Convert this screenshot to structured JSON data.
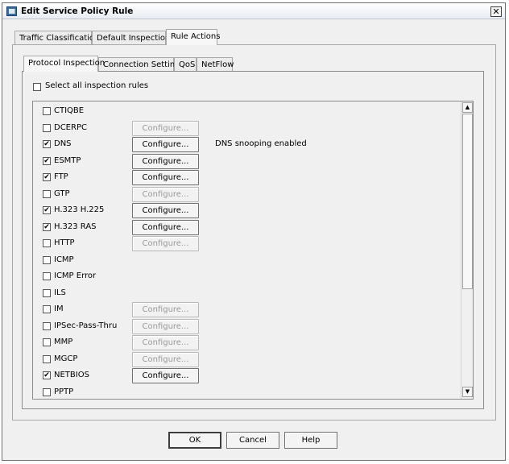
{
  "window": {
    "title": "Edit Service Policy Rule",
    "close_glyph": "✕"
  },
  "outer_tabs": [
    {
      "label": "Traffic Classification"
    },
    {
      "label": "Default Inspections"
    },
    {
      "label": "Rule Actions"
    }
  ],
  "inner_tabs": [
    {
      "label": "Protocol Inspection"
    },
    {
      "label": "Connection Settings"
    },
    {
      "label": "QoS"
    },
    {
      "label": "NetFlow"
    }
  ],
  "select_all": {
    "label": "Select all inspection rules",
    "checked": false
  },
  "rules": [
    {
      "name": "CTIQBE",
      "checked": false,
      "configure": null,
      "note": ""
    },
    {
      "name": "DCERPC",
      "checked": false,
      "configure": "Configure...",
      "enabled": false,
      "note": ""
    },
    {
      "name": "DNS",
      "checked": true,
      "configure": "Configure...",
      "enabled": true,
      "note": "DNS snooping enabled"
    },
    {
      "name": "ESMTP",
      "checked": true,
      "configure": "Configure...",
      "enabled": true,
      "note": ""
    },
    {
      "name": "FTP",
      "checked": true,
      "configure": "Configure...",
      "enabled": true,
      "note": ""
    },
    {
      "name": "GTP",
      "checked": false,
      "configure": "Configure...",
      "enabled": false,
      "note": ""
    },
    {
      "name": "H.323 H.225",
      "checked": true,
      "configure": "Configure...",
      "enabled": true,
      "note": ""
    },
    {
      "name": "H.323 RAS",
      "checked": true,
      "configure": "Configure...",
      "enabled": true,
      "note": ""
    },
    {
      "name": "HTTP",
      "checked": false,
      "configure": "Configure...",
      "enabled": false,
      "note": ""
    },
    {
      "name": "ICMP",
      "checked": false,
      "configure": null,
      "note": ""
    },
    {
      "name": "ICMP Error",
      "checked": false,
      "configure": null,
      "note": ""
    },
    {
      "name": "ILS",
      "checked": false,
      "configure": null,
      "note": ""
    },
    {
      "name": "IM",
      "checked": false,
      "configure": "Configure...",
      "enabled": false,
      "note": ""
    },
    {
      "name": "IPSec-Pass-Thru",
      "checked": false,
      "configure": "Configure...",
      "enabled": false,
      "note": ""
    },
    {
      "name": "MMP",
      "checked": false,
      "configure": "Configure...",
      "enabled": false,
      "note": ""
    },
    {
      "name": "MGCP",
      "checked": false,
      "configure": "Configure...",
      "enabled": false,
      "note": ""
    },
    {
      "name": "NETBIOS",
      "checked": true,
      "configure": "Configure...",
      "enabled": true,
      "note": ""
    },
    {
      "name": "PPTP",
      "checked": false,
      "configure": null,
      "note": ""
    }
  ],
  "buttons": {
    "ok": "OK",
    "cancel": "Cancel",
    "help": "Help"
  },
  "colors": {
    "window_bg": "#f0f0f0",
    "disabled_text": "#9a9a9a"
  }
}
